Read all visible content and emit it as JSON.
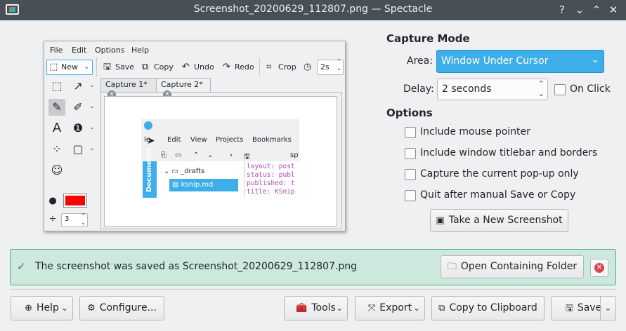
{
  "window": {
    "title": "Screenshot_20200629_112807.png — Spectacle",
    "controls": [
      "?",
      "⌄",
      "⌃",
      "✕"
    ]
  },
  "preview": {
    "menu": [
      "File",
      "Edit",
      "Options",
      "Help"
    ],
    "toolbar": {
      "new": "New",
      "save": "Save",
      "copy": "Copy",
      "undo": "Undo",
      "redo": "Redo",
      "crop": "Crop",
      "delay_value": "2s"
    },
    "tabs": [
      "Capture 1*",
      "Capture 2*"
    ],
    "pen_width": "3",
    "nested": {
      "menu": [
        "le",
        "Edit",
        "View",
        "Projects",
        "Bookmarks"
      ],
      "toolbar_text": "sp",
      "sidebar": "Documents",
      "tree": [
        "_drafts",
        "ksnip.md"
      ],
      "code": [
        "layout: post",
        "status: publ",
        "published: t",
        "title: KSnip"
      ]
    }
  },
  "capture_mode": {
    "heading": "Capture Mode",
    "area_label": "Area:",
    "area_value": "Window Under Cursor",
    "delay_label": "Delay:",
    "delay_value": "2 seconds",
    "on_click_label": "On Click"
  },
  "options": {
    "heading": "Options",
    "items": [
      "Include mouse pointer",
      "Include window titlebar and borders",
      "Capture the current pop-up only",
      "Quit after manual Save or Copy"
    ]
  },
  "take_screenshot_label": "Take a New Screenshot",
  "message": {
    "prefix": "The screenshot was saved as ",
    "file_link": "Screenshot_20200629_112807.png",
    "open_folder_label": "Open Containing Folder"
  },
  "bottom": {
    "help": "Help",
    "configure": "Configure...",
    "tools": "Tools",
    "export": "Export",
    "copy_clipboard": "Copy to Clipboard",
    "save": "Save"
  },
  "colors": {
    "titlebar": "#475057",
    "accent": "#3daee9",
    "success_bg": "#cde8dc",
    "success_border": "#4bb37a",
    "danger": "#da4453",
    "pen_color": "#ff0000"
  }
}
